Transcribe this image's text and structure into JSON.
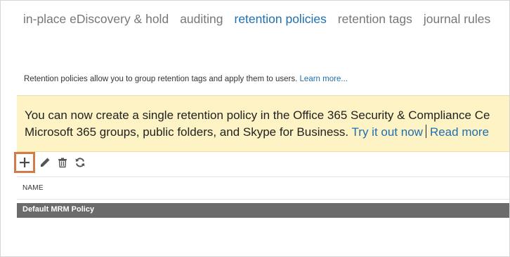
{
  "tabs": [
    {
      "label": "in-place eDiscovery & hold",
      "active": false
    },
    {
      "label": "auditing",
      "active": false
    },
    {
      "label": "retention policies",
      "active": true
    },
    {
      "label": "retention tags",
      "active": false
    },
    {
      "label": "journal rules",
      "active": false
    }
  ],
  "description": {
    "text": "Retention policies allow you to group retention tags and apply them to users.",
    "link": "Learn more..."
  },
  "banner": {
    "line1": "You can now create a single retention policy in the Office 365 Security & Compliance Ce",
    "line2_text": "Microsoft 365 groups, public folders, and Skype for Business.",
    "link1": "Try it out now",
    "link2": "Read more"
  },
  "toolbar": {
    "icons": [
      "add-icon",
      "edit-icon",
      "delete-icon",
      "refresh-icon"
    ]
  },
  "table": {
    "columns": [
      "NAME"
    ],
    "rows": [
      {
        "name": "Default MRM Policy",
        "selected": true
      }
    ]
  },
  "colors": {
    "accent": "#1f6fb0",
    "banner_bg": "#fdf3c5",
    "selected_row": "#6b6b6b",
    "highlight_box": "#d47a4a"
  }
}
